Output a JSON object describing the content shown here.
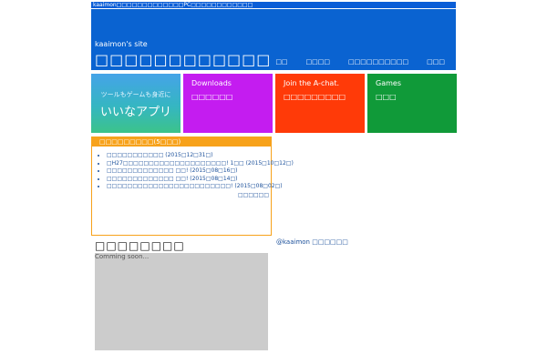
{
  "topbar": {
    "text": "kaaimon□□□□□□□□□□□□□PC□□□□□□□□□□□□"
  },
  "header": {
    "site_name": "kaaimon's site",
    "title": "□□□□□□□□□□□□",
    "nav": [
      "□□",
      "□□□□",
      "□□□□□□□□□□",
      "□□□"
    ]
  },
  "tiles": [
    {
      "subtitle": "ツールもゲームも身近に",
      "title": "いいなアプリ",
      "color": "#3aaed0"
    },
    {
      "title": "Downloads",
      "subtitle": "□□□□□□",
      "color": "#c41cf0"
    },
    {
      "title": "Join the A-chat.",
      "subtitle": "□□□□□□□□□",
      "color": "#ff3a08"
    },
    {
      "title": "Games",
      "subtitle": "□□□",
      "color": "#109a39"
    }
  ],
  "news": {
    "header": "□□□□□□□□□(5□□□)",
    "items": [
      "□□□□□□□□□□□ (2015□12□31□)",
      "□H27□□□□□□□□□□□□□□□□□□□□! 1□□ (2015□10□12□)",
      "□□□□□□□□□□□□□ □□! (2015□08□16□)",
      "□□□□□□□□□□□□□ □□! (2015□08□14□)",
      "□□□□□□□□□□□□□□□□□□□□□□□□! (2015□08□02□)"
    ],
    "more": "□□□□□□"
  },
  "section": {
    "title": "□□□□□□□□",
    "status": "Comming soon..."
  },
  "twitter": {
    "link": "@kaaimon □□□□□□"
  },
  "colors": {
    "header_blue": "#0a63d1",
    "news_orange": "#f7a21b",
    "link_blue": "#1a4f9a"
  }
}
